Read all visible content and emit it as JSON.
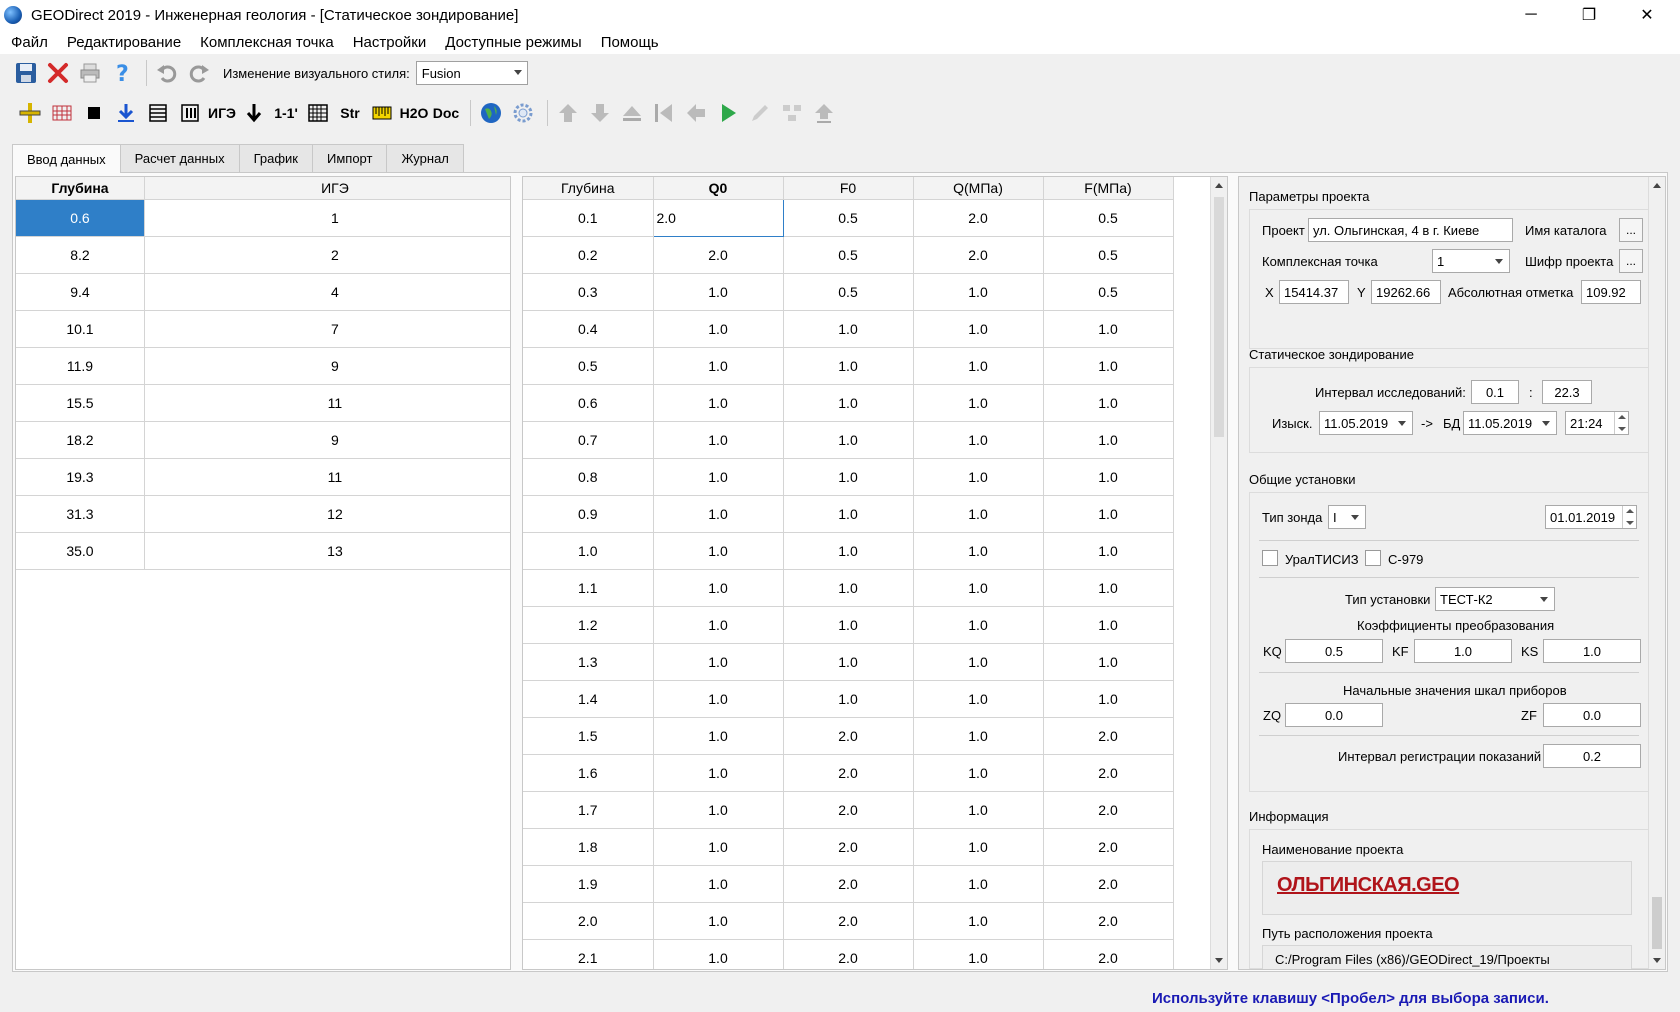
{
  "window": {
    "title": "GEODirect 2019 - Инженерная геология - [Статическое зондирование]",
    "minimize": "─",
    "maximize": "❐",
    "close": "✕"
  },
  "menu": [
    "Файл",
    "Редактирование",
    "Комплексная точка",
    "Настройки",
    "Доступные режимы",
    "Помощь"
  ],
  "toolbar1": {
    "style_label": "Изменение визуального стиля:",
    "style_value": "Fusion"
  },
  "toolbar2": {
    "text_buttons": [
      "ИГЭ",
      "1-1'",
      "Str",
      "H2O",
      "Doc"
    ]
  },
  "tabs": [
    "Ввод данных",
    "Расчет данных",
    "График",
    "Импорт",
    "Журнал"
  ],
  "left_table": {
    "headers": [
      "Глубина",
      "ИГЭ"
    ],
    "rows": [
      [
        "0.6",
        "1"
      ],
      [
        "8.2",
        "2"
      ],
      [
        "9.4",
        "4"
      ],
      [
        "10.1",
        "7"
      ],
      [
        "11.9",
        "9"
      ],
      [
        "15.5",
        "11"
      ],
      [
        "18.2",
        "9"
      ],
      [
        "19.3",
        "11"
      ],
      [
        "31.3",
        "12"
      ],
      [
        "35.0",
        "13"
      ]
    ]
  },
  "mid_table": {
    "headers": [
      "Глубина",
      "Q0",
      "F0",
      "Q(МПа)",
      "F(МПа)"
    ],
    "rows": [
      [
        "0.1",
        "2.0",
        "0.5",
        "2.0",
        "0.5"
      ],
      [
        "0.2",
        "2.0",
        "0.5",
        "2.0",
        "0.5"
      ],
      [
        "0.3",
        "1.0",
        "0.5",
        "1.0",
        "0.5"
      ],
      [
        "0.4",
        "1.0",
        "1.0",
        "1.0",
        "1.0"
      ],
      [
        "0.5",
        "1.0",
        "1.0",
        "1.0",
        "1.0"
      ],
      [
        "0.6",
        "1.0",
        "1.0",
        "1.0",
        "1.0"
      ],
      [
        "0.7",
        "1.0",
        "1.0",
        "1.0",
        "1.0"
      ],
      [
        "0.8",
        "1.0",
        "1.0",
        "1.0",
        "1.0"
      ],
      [
        "0.9",
        "1.0",
        "1.0",
        "1.0",
        "1.0"
      ],
      [
        "1.0",
        "1.0",
        "1.0",
        "1.0",
        "1.0"
      ],
      [
        "1.1",
        "1.0",
        "1.0",
        "1.0",
        "1.0"
      ],
      [
        "1.2",
        "1.0",
        "1.0",
        "1.0",
        "1.0"
      ],
      [
        "1.3",
        "1.0",
        "1.0",
        "1.0",
        "1.0"
      ],
      [
        "1.4",
        "1.0",
        "1.0",
        "1.0",
        "1.0"
      ],
      [
        "1.5",
        "1.0",
        "2.0",
        "1.0",
        "2.0"
      ],
      [
        "1.6",
        "1.0",
        "2.0",
        "1.0",
        "2.0"
      ],
      [
        "1.7",
        "1.0",
        "2.0",
        "1.0",
        "2.0"
      ],
      [
        "1.8",
        "1.0",
        "2.0",
        "1.0",
        "2.0"
      ],
      [
        "1.9",
        "1.0",
        "2.0",
        "1.0",
        "2.0"
      ],
      [
        "2.0",
        "1.0",
        "2.0",
        "1.0",
        "2.0"
      ],
      [
        "2.1",
        "1.0",
        "2.0",
        "1.0",
        "2.0"
      ]
    ]
  },
  "panel": {
    "project_params": {
      "title": "Параметры проекта",
      "project_label": "Проект",
      "project_value": "ул. Ольгинская, 4 в г. Киеве",
      "catalog_label": "Имя каталога",
      "complex_point_label": "Комплексная точка",
      "complex_point_value": "1",
      "cipher_label": "Шифр проекта",
      "x_label": "X",
      "x_value": "15414.37",
      "y_label": "Y",
      "y_value": "19262.66",
      "abs_label": "Абсолютная отметка",
      "abs_value": "109.92",
      "dots": "..."
    },
    "static": {
      "title": "Статическое зондирование",
      "interval_label": "Интервал исследований:",
      "interval_from": "0.1",
      "interval_sep": ":",
      "interval_to": "22.3",
      "izysk_label": "Изыск.",
      "izysk_date": "11.05.2019",
      "arrow": "->",
      "bd_label": "БД",
      "bd_date": "11.05.2019",
      "time": "21:24"
    },
    "general": {
      "title": "Общие установки",
      "probe_type_label": "Тип зонда",
      "probe_type_value": "I",
      "probe_date": "01.01.2019",
      "chk1_label": "УралТИСИЗ",
      "chk2_label": "С-979",
      "install_type_label": "Тип установки",
      "install_type_value": "ТЕСТ-К2",
      "coef_title": "Коэффициенты преобразования",
      "kq_label": "KQ",
      "kq_value": "0.5",
      "kf_label": "KF",
      "kf_value": "1.0",
      "ks_label": "KS",
      "ks_value": "1.0",
      "initial_title": "Начальные значения шкал приборов",
      "zq_label": "ZQ",
      "zq_value": "0.0",
      "zf_label": "ZF",
      "zf_value": "0.0",
      "reg_interval_label": "Интервал регистрации показаний",
      "reg_interval_value": "0.2"
    },
    "info": {
      "title": "Информация",
      "project_name_label": "Наименование проекта",
      "logo_text": "ОЛЬГИНСКАЯ.GEO",
      "path_label": "Путь расположения проекта",
      "path_value": "C:/Program Files (x86)/GEODirect_19/Проекты"
    }
  },
  "status": "Используйте клавишу <Пробел> для выбора записи.",
  "colors": {
    "selection": "#2f7fc8",
    "status_text": "#1a1ab4",
    "logo": "#b0141a"
  }
}
